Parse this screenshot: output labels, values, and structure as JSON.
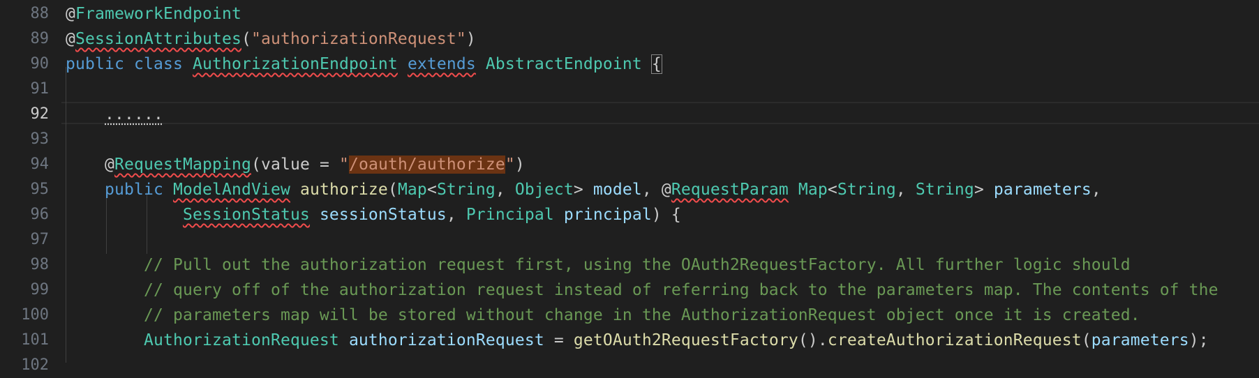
{
  "editor": {
    "lines": [
      {
        "num": "88",
        "tokens": [
          {
            "t": "@",
            "c": "pl"
          },
          {
            "t": "FrameworkEndpoint",
            "c": "an"
          }
        ]
      },
      {
        "num": "89",
        "tokens": [
          {
            "t": "@",
            "c": "pl"
          },
          {
            "t": "SessionAttributes",
            "c": "an squig"
          },
          {
            "t": "(",
            "c": "pl"
          },
          {
            "t": "\"authorizationRequest\"",
            "c": "str"
          },
          {
            "t": ")",
            "c": "pl"
          }
        ]
      },
      {
        "num": "90",
        "tokens": [
          {
            "t": "public",
            "c": "kw"
          },
          {
            "t": " ",
            "c": "pl"
          },
          {
            "t": "class",
            "c": "kw"
          },
          {
            "t": " ",
            "c": "pl"
          },
          {
            "t": "AuthorizationEndpoint",
            "c": "ty squig"
          },
          {
            "t": " ",
            "c": "pl"
          },
          {
            "t": "extends",
            "c": "kw squig"
          },
          {
            "t": " ",
            "c": "pl"
          },
          {
            "t": "AbstractEndpoint",
            "c": "ty"
          },
          {
            "t": " ",
            "c": "pl"
          },
          {
            "t": "{",
            "c": "pl bracket"
          }
        ]
      },
      {
        "num": "91",
        "tokens": []
      },
      {
        "num": "92",
        "active": true,
        "tokens": [
          {
            "t": "    ",
            "c": "pl"
          },
          {
            "t": "......",
            "c": "pl squig-dot"
          }
        ]
      },
      {
        "num": "93",
        "tokens": []
      },
      {
        "num": "94",
        "tokens": [
          {
            "t": "    ",
            "c": "pl"
          },
          {
            "t": "@",
            "c": "pl"
          },
          {
            "t": "RequestMapping",
            "c": "an squig"
          },
          {
            "t": "(value = ",
            "c": "pl"
          },
          {
            "t": "\"",
            "c": "str"
          },
          {
            "t": "/oauth/authorize",
            "c": "str hl"
          },
          {
            "t": "\"",
            "c": "str"
          },
          {
            "t": ")",
            "c": "pl"
          }
        ]
      },
      {
        "num": "95",
        "tokens": [
          {
            "t": "    ",
            "c": "pl"
          },
          {
            "t": "public",
            "c": "kw"
          },
          {
            "t": " ",
            "c": "pl"
          },
          {
            "t": "ModelAndView",
            "c": "ty squig"
          },
          {
            "t": " ",
            "c": "pl"
          },
          {
            "t": "authorize",
            "c": "fn"
          },
          {
            "t": "(",
            "c": "pl"
          },
          {
            "t": "Map",
            "c": "ty"
          },
          {
            "t": "<",
            "c": "pl"
          },
          {
            "t": "String",
            "c": "ty"
          },
          {
            "t": ", ",
            "c": "pl"
          },
          {
            "t": "Object",
            "c": "ty"
          },
          {
            "t": "> ",
            "c": "pl"
          },
          {
            "t": "model",
            "c": "var"
          },
          {
            "t": ", ",
            "c": "pl"
          },
          {
            "t": "@",
            "c": "pl"
          },
          {
            "t": "RequestParam",
            "c": "an squig"
          },
          {
            "t": " ",
            "c": "pl"
          },
          {
            "t": "Map",
            "c": "ty"
          },
          {
            "t": "<",
            "c": "pl"
          },
          {
            "t": "String",
            "c": "ty"
          },
          {
            "t": ", ",
            "c": "pl"
          },
          {
            "t": "String",
            "c": "ty"
          },
          {
            "t": "> ",
            "c": "pl"
          },
          {
            "t": "parameters",
            "c": "var"
          },
          {
            "t": ",",
            "c": "pl"
          }
        ]
      },
      {
        "num": "96",
        "tokens": [
          {
            "t": "            ",
            "c": "pl"
          },
          {
            "t": "SessionStatus",
            "c": "ty squig"
          },
          {
            "t": " ",
            "c": "pl"
          },
          {
            "t": "sessionStatus",
            "c": "var"
          },
          {
            "t": ", ",
            "c": "pl"
          },
          {
            "t": "Principal",
            "c": "ty"
          },
          {
            "t": " ",
            "c": "pl"
          },
          {
            "t": "principal",
            "c": "var"
          },
          {
            "t": ") {",
            "c": "pl"
          }
        ]
      },
      {
        "num": "97",
        "tokens": []
      },
      {
        "num": "98",
        "tokens": [
          {
            "t": "        ",
            "c": "pl"
          },
          {
            "t": "// Pull out the authorization request first, using the OAuth2RequestFactory. All further logic should",
            "c": "cm"
          }
        ]
      },
      {
        "num": "99",
        "tokens": [
          {
            "t": "        ",
            "c": "pl"
          },
          {
            "t": "// query off of the authorization request instead of referring back to the parameters map. The contents of the",
            "c": "cm"
          }
        ]
      },
      {
        "num": "100",
        "tokens": [
          {
            "t": "        ",
            "c": "pl"
          },
          {
            "t": "// parameters map will be stored without change in the AuthorizationRequest object once it is created.",
            "c": "cm"
          }
        ]
      },
      {
        "num": "101",
        "tokens": [
          {
            "t": "        ",
            "c": "pl"
          },
          {
            "t": "AuthorizationRequest",
            "c": "ty"
          },
          {
            "t": " ",
            "c": "pl"
          },
          {
            "t": "authorizationRequest",
            "c": "var"
          },
          {
            "t": " = ",
            "c": "pl"
          },
          {
            "t": "getOAuth2RequestFactory",
            "c": "fn"
          },
          {
            "t": "().",
            "c": "pl"
          },
          {
            "t": "createAuthorizationRequest",
            "c": "fn"
          },
          {
            "t": "(",
            "c": "pl"
          },
          {
            "t": "parameters",
            "c": "var"
          },
          {
            "t": ");",
            "c": "pl"
          }
        ]
      },
      {
        "num": "102",
        "tokens": []
      }
    ]
  }
}
